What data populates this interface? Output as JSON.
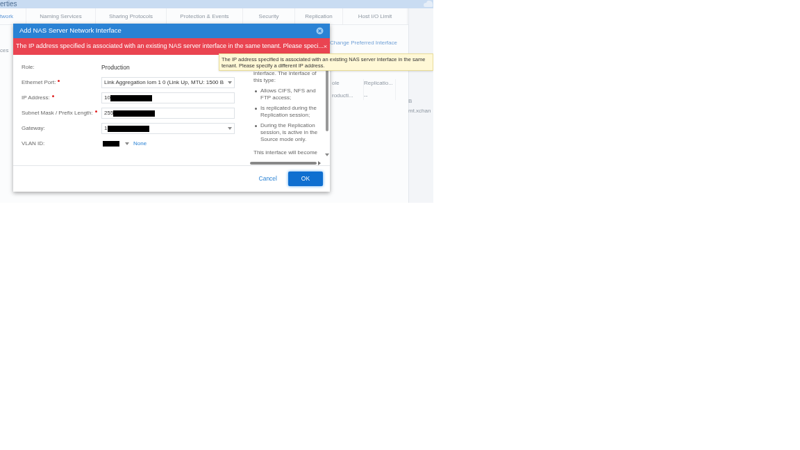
{
  "background_page": {
    "title": "erties",
    "tabs": [
      {
        "label": "twork",
        "selected": true
      },
      {
        "label": "Naming Services",
        "selected": false
      },
      {
        "label": "Sharing Protocols",
        "selected": false
      },
      {
        "label": "Protection & Events",
        "selected": false
      },
      {
        "label": "Security",
        "selected": false
      },
      {
        "label": "Replication",
        "selected": false
      },
      {
        "label": "Host I/O Limit",
        "selected": false
      }
    ],
    "side_text": "ces",
    "link": "Change Preferred Interface",
    "table": {
      "columns": [
        "ole",
        "Replicatio..."
      ],
      "rows": [
        [
          "roducti...",
          "--"
        ]
      ]
    },
    "extra_texts": [
      "B",
      "mt.xchan"
    ]
  },
  "dialog": {
    "title": "Add NAS Server Network Interface",
    "error": "The IP address specified is associated with an existing NAS server interface in the same tenant. Please speci...",
    "tooltip": "The IP address specified is associated with an existing NAS server interface in the same tenant. Please specify a different IP address.",
    "fields": [
      {
        "label": "Role:",
        "required": false,
        "kind": "text",
        "value": "Production",
        "redacted": false
      },
      {
        "label": "Ethernet Port:",
        "required": true,
        "kind": "select",
        "value": "Link Aggregation Iom 1 0 (Link Up, MTU: 1500 B",
        "redacted": false
      },
      {
        "label": "IP Address:",
        "required": true,
        "kind": "input",
        "value": "10",
        "redacted": true
      },
      {
        "label": "Subnet Mask / Prefix Length:",
        "required": true,
        "kind": "input",
        "value": "255",
        "redacted": true
      },
      {
        "label": "Gateway:",
        "required": false,
        "kind": "select",
        "value": "1",
        "redacted": true
      },
      {
        "label": "VLAN ID:",
        "required": false,
        "kind": "small_select",
        "redacted": true,
        "link": "None"
      }
    ],
    "help": {
      "intro": "interface. The interface of this type:",
      "bullets": [
        "Allows CIFS, NFS and FTP access;",
        "Is replicated during the Replication session;",
        "During the Replication session, is active in the Source mode only."
      ],
      "more": "This interface will become"
    },
    "buttons": [
      {
        "label": "Cancel",
        "kind": "link"
      },
      {
        "label": "OK",
        "kind": "primary"
      }
    ]
  }
}
